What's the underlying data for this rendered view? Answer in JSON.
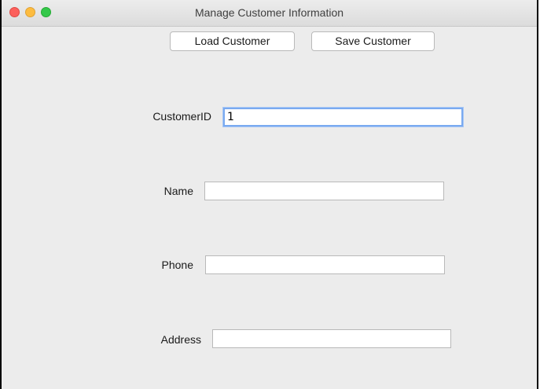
{
  "window": {
    "title": "Manage Customer Information"
  },
  "toolbar": {
    "load_label": "Load Customer",
    "save_label": "Save Customer"
  },
  "form": {
    "customer_id": {
      "label": "CustomerID",
      "value": "1"
    },
    "name": {
      "label": "Name",
      "value": ""
    },
    "phone": {
      "label": "Phone",
      "value": ""
    },
    "address": {
      "label": "Address",
      "value": ""
    }
  },
  "colors": {
    "close": "#fc605c",
    "minimize": "#fdbc40",
    "maximize": "#34c84a",
    "focus_ring": "#7aaaf0"
  }
}
